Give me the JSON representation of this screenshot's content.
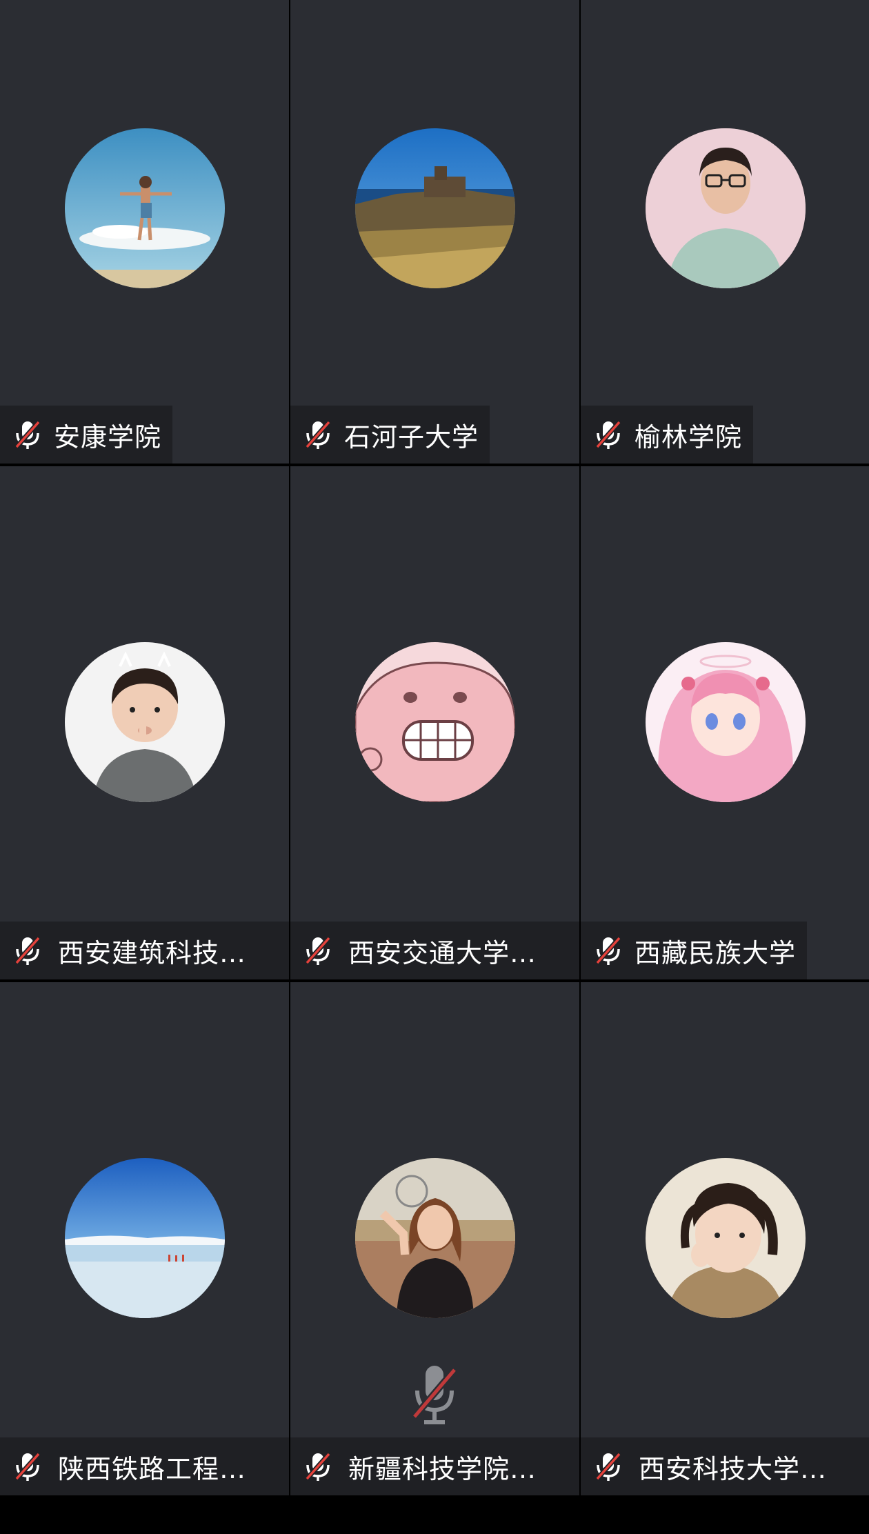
{
  "participants": [
    {
      "name": "安康学院",
      "avatar": "boy-jumping-on-cloud"
    },
    {
      "name": "石河子大学",
      "avatar": "castle-cliff-landscape"
    },
    {
      "name": "榆林学院",
      "avatar": "woman-with-glasses"
    },
    {
      "name": "西安建筑科技…",
      "avatar": "child-cat-ears"
    },
    {
      "name": "西安交通大学…",
      "avatar": "pink-cartoon-grin"
    },
    {
      "name": "西藏民族大学",
      "avatar": "pink-anime-girl"
    },
    {
      "name": "陕西铁路工程…",
      "avatar": "salt-lake-sky"
    },
    {
      "name": "新疆科技学院…",
      "avatar": "woman-in-flower-field"
    },
    {
      "name": "西安科技大学…",
      "avatar": "little-girl-pigtails"
    }
  ],
  "icons": {
    "participant_mic": "mic-muted-icon",
    "floating_mic": "mic-muted-icon"
  },
  "colors": {
    "tile_bg": "#2b2d33",
    "name_tag_bg": "#1f2024",
    "mute_slash": "#e5413b",
    "text": "#ffffff"
  }
}
